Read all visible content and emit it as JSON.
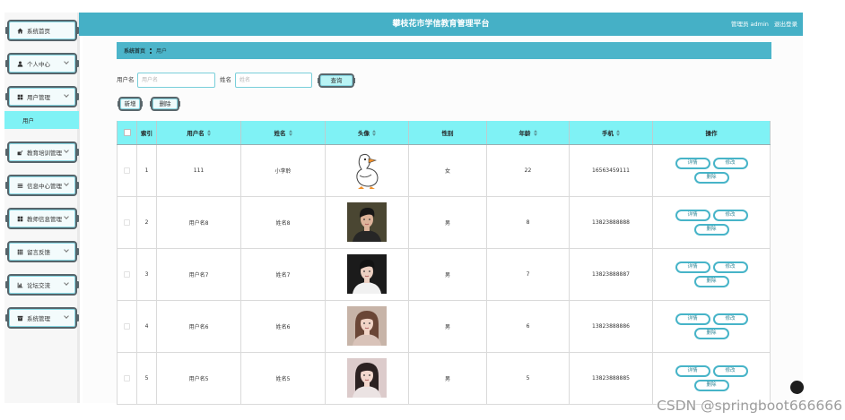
{
  "app": {
    "title": "攀枝花市学信教育管理平台",
    "user": "管理员 admin",
    "logout": "退出登录"
  },
  "sidebar": {
    "items": [
      {
        "label": "系统首页",
        "icon": "home-icon"
      },
      {
        "label": "个人中心",
        "icon": "person-icon"
      },
      {
        "label": "用户管理",
        "icon": "grid-icon"
      },
      {
        "label": "教育培训管理",
        "icon": "edit-icon"
      },
      {
        "label": "信息中心管理",
        "icon": "list-icon"
      },
      {
        "label": "教师信息管理",
        "icon": "grid-icon"
      },
      {
        "label": "留言反馈",
        "icon": "table-icon"
      },
      {
        "label": "论坛交流",
        "icon": "chart-icon"
      },
      {
        "label": "系统管理",
        "icon": "archive-icon"
      }
    ],
    "subitems": [
      {
        "label": "用户",
        "active": true
      }
    ]
  },
  "breadcrumb": {
    "home": "系统首页",
    "current": "用户"
  },
  "search": {
    "username_label": "用户名",
    "username_placeholder": "用户名",
    "name_label": "姓名",
    "name_placeholder": "姓名",
    "query_button": "查询"
  },
  "toolbar": {
    "add_button": "新增",
    "delete_button": "删除"
  },
  "table": {
    "columns": [
      {
        "label": "索引",
        "sortable": false
      },
      {
        "label": "用户名",
        "sortable": true
      },
      {
        "label": "姓名",
        "sortable": true
      },
      {
        "label": "头像",
        "sortable": true
      },
      {
        "label": "性别",
        "sortable": false
      },
      {
        "label": "年龄",
        "sortable": true
      },
      {
        "label": "手机",
        "sortable": true
      },
      {
        "label": "操作",
        "sortable": false
      }
    ],
    "rows": [
      {
        "index": "1",
        "username": "111",
        "name": "小李聆",
        "avatar": "goose-avatar",
        "gender": "女",
        "age": "22",
        "phone": "16563459111"
      },
      {
        "index": "2",
        "username": "用户名8",
        "name": "姓名8",
        "avatar": "male-avatar-a",
        "gender": "男",
        "age": "8",
        "phone": "13823888888"
      },
      {
        "index": "3",
        "username": "用户名7",
        "name": "姓名7",
        "avatar": "male-avatar-b",
        "gender": "男",
        "age": "7",
        "phone": "13823888887"
      },
      {
        "index": "4",
        "username": "用户名6",
        "name": "姓名6",
        "avatar": "female-avatar-a",
        "gender": "男",
        "age": "6",
        "phone": "13823888886"
      },
      {
        "index": "5",
        "username": "用户名5",
        "name": "姓名5",
        "avatar": "female-avatar-b",
        "gender": "男",
        "age": "5",
        "phone": "13823888885"
      }
    ],
    "row_actions": {
      "detail": "详情",
      "edit": "修改",
      "delete": "删除"
    }
  },
  "watermark": "CSDN @springboot666666",
  "colors": {
    "primary": "#45b0c6",
    "table_header": "#7ff2f5",
    "active_menu": "#7ff2f5",
    "action_border": "#47b4c8"
  }
}
